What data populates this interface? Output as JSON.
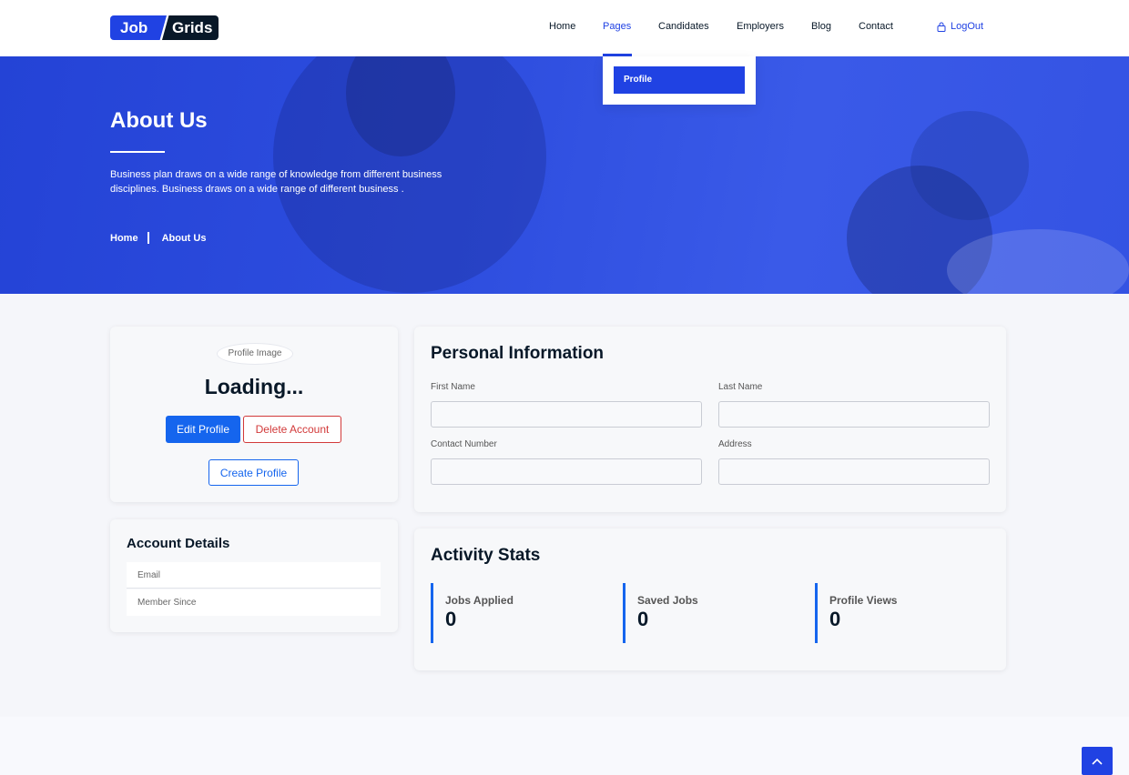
{
  "brand": {
    "part1": "Job",
    "part2": "Grids"
  },
  "nav": {
    "items": [
      "Home",
      "Pages",
      "Candidates",
      "Employers",
      "Blog",
      "Contact"
    ],
    "active": "Pages",
    "logout": "LogOut",
    "dropdown_item": "Profile"
  },
  "hero": {
    "title": "About Us",
    "description": "Business plan draws on a wide range of knowledge from different business disciplines. Business draws on a wide range of different business .",
    "breadcrumb": [
      "Home",
      "About Us"
    ]
  },
  "profile": {
    "image_alt": "Profile Image",
    "name": "Loading...",
    "edit_label": "Edit Profile",
    "delete_label": "Delete Account",
    "create_label": "Create Profile"
  },
  "account": {
    "title": "Account Details",
    "email_label": "Email",
    "member_since_label": "Member Since"
  },
  "personal": {
    "title": "Personal Information",
    "first_name_label": "First Name",
    "last_name_label": "Last Name",
    "contact_label": "Contact Number",
    "address_label": "Address",
    "first_name_value": "",
    "last_name_value": "",
    "contact_value": "",
    "address_value": ""
  },
  "activity": {
    "title": "Activity Stats",
    "stats": [
      {
        "label": "Jobs Applied",
        "value": "0"
      },
      {
        "label": "Saved Jobs",
        "value": "0"
      },
      {
        "label": "Profile Views",
        "value": "0"
      }
    ]
  },
  "colors": {
    "primary": "#2042e3",
    "button_blue": "#1565ee",
    "danger": "#d23a3a",
    "dark": "#081828"
  }
}
